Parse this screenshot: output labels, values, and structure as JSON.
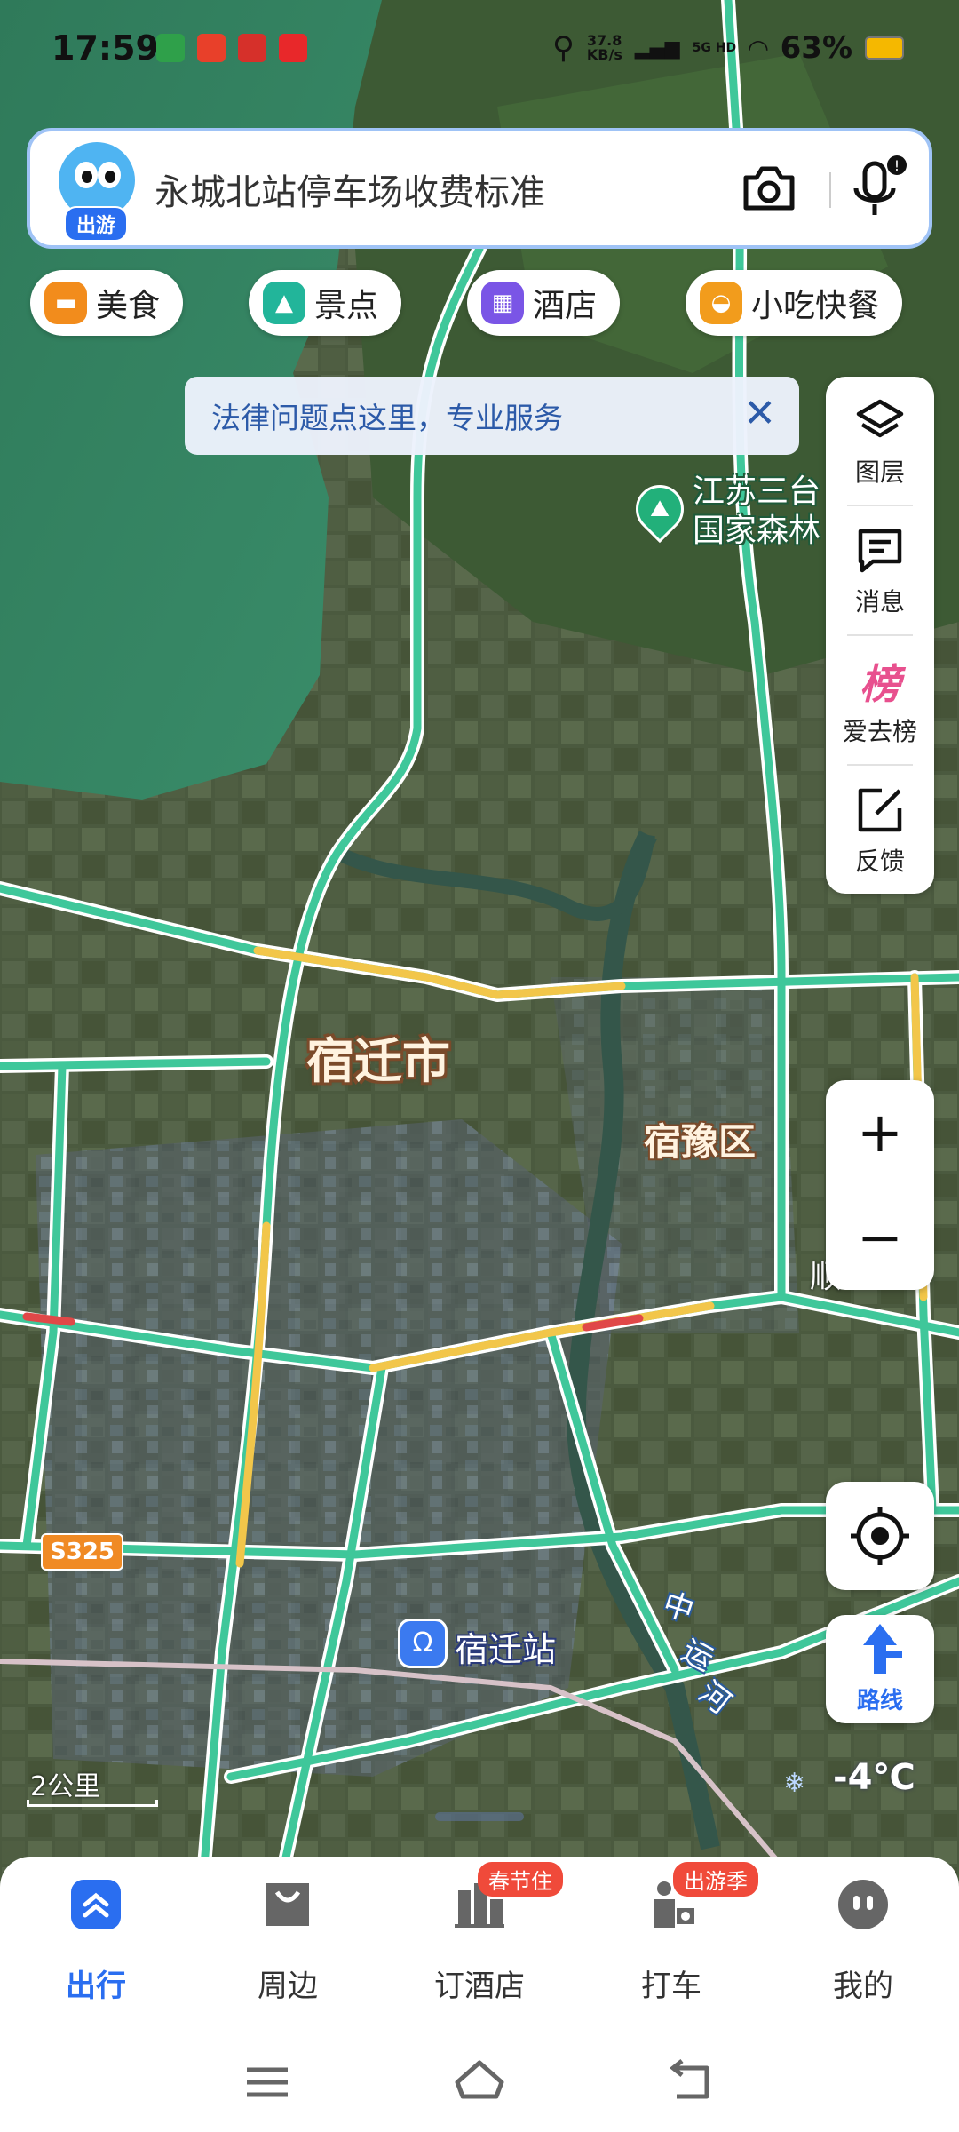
{
  "status_bar": {
    "time": "17:59",
    "net_speed_value": "37.8",
    "net_speed_unit": "KB/s",
    "signal": "5G HD",
    "battery": "63%"
  },
  "search": {
    "avatar_badge": "出游",
    "query": "永城北站停车场收费标准"
  },
  "categories": [
    {
      "label": "美食",
      "icon": "food-icon",
      "color": "#f28c1c"
    },
    {
      "label": "景点",
      "icon": "scenic-icon",
      "color": "#22b59a"
    },
    {
      "label": "酒店",
      "icon": "hotel-icon",
      "color": "#7a55e6"
    },
    {
      "label": "小吃快餐",
      "icon": "snack-icon",
      "color": "#f29c1c"
    }
  ],
  "notice": {
    "text": "法律问题点这里，专业服务",
    "close": "✕"
  },
  "side_panel": [
    {
      "label": "图层",
      "icon": "layers-icon"
    },
    {
      "label": "消息",
      "icon": "message-icon"
    },
    {
      "label": "爱去榜",
      "icon": "ranking-icon",
      "glyph": "榜"
    },
    {
      "label": "反馈",
      "icon": "feedback-icon"
    }
  ],
  "zoom": {
    "plus": "+",
    "minus": "−"
  },
  "route_button": {
    "label": "路线"
  },
  "map": {
    "city": "宿迁市",
    "district": "宿豫区",
    "poi_line1": "江苏三台",
    "poi_line2": "国家森林",
    "station": "宿迁站",
    "canal_chars": [
      "中",
      "运",
      "河"
    ],
    "road_shield": "S325",
    "scale": "2公里",
    "temperature": "-4℃",
    "partial_label": "顺"
  },
  "bottom_nav": [
    {
      "label": "出行",
      "icon": "travel-icon",
      "active": true
    },
    {
      "label": "周边",
      "icon": "nearby-icon",
      "active": false
    },
    {
      "label": "订酒店",
      "icon": "hotel-booking-icon",
      "active": false,
      "badge": "春节住"
    },
    {
      "label": "打车",
      "icon": "taxi-icon",
      "active": false,
      "badge": "出游季"
    },
    {
      "label": "我的",
      "icon": "profile-icon",
      "active": false
    }
  ],
  "colors": {
    "accent": "#2a6ef0",
    "road_green": "#3fc79a",
    "road_yellow": "#f2c64a",
    "badge_red": "#f04a3a"
  }
}
